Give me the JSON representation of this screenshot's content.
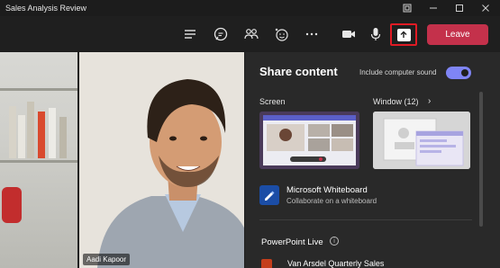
{
  "window": {
    "title": "Sales Analysis Review"
  },
  "toolbar": {
    "leave_label": "Leave",
    "icons": [
      "list-icon",
      "chat-icon",
      "people-icon",
      "reactions-icon",
      "more-icon",
      "camera-icon",
      "mic-icon",
      "share-icon"
    ],
    "accent_leave": "#c4314b",
    "highlight": "#e01b24"
  },
  "video": {
    "participant_name": "Aadi Kapoor"
  },
  "share_panel": {
    "title": "Share content",
    "include_sound_label": "Include computer sound",
    "include_sound_on": true,
    "toggle_color": "#7f85f5",
    "screen_label": "Screen",
    "window_label": "Window (12)",
    "whiteboard": {
      "title": "Microsoft Whiteboard",
      "subtitle": "Collaborate on a whiteboard"
    },
    "powerpoint_label": "PowerPoint Live",
    "files": [
      "Van Arsdel Quarterly Sales"
    ]
  }
}
